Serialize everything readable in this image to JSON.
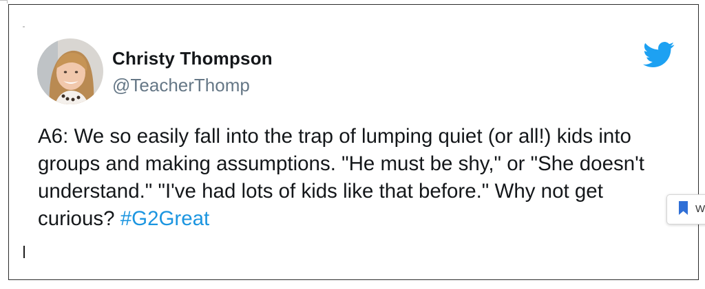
{
  "tweet": {
    "author_name": "Christy Thompson",
    "author_handle": "@TeacherThomp",
    "text": "A6: We so easily fall into the trap of lumping quiet (or all!) kids into groups and making assumptions. \"He must be shy,\" or \"She doesn't understand.\" \"I've had lots of kids like that before.\" Why not get curious?",
    "hashtag": "#G2Great",
    "hashtag_color": "#1b95e0",
    "avatar_icon": "profile-photo",
    "logo_icon": "twitter-bird-icon",
    "logo_color": "#1da1f2"
  },
  "side_widget": {
    "icon": "bookmark-icon",
    "icon_color": "#2f6fd6",
    "label": "W"
  }
}
